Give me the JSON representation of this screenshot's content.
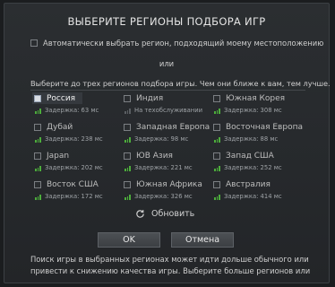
{
  "dialog": {
    "title": "ВЫБЕРИТЕ РЕГИОНЫ ПОДБОРА ИГР",
    "auto_select_label": "Автоматически выбрать регион, подходящий моему местоположению",
    "auto_select_checked": false,
    "or_label": "или",
    "instructions": "Выберите до трех регионов подбора игры. Чем они ближе к вам, тем лучше.",
    "regions": [
      {
        "name": "Россия",
        "latency": "Задержка: 63 мс",
        "selected": true,
        "signal": "good"
      },
      {
        "name": "Индия",
        "latency": "На техобслуживании",
        "selected": false,
        "signal": "off"
      },
      {
        "name": "Южная Корея",
        "latency": "Задержка: 308 мс",
        "selected": false,
        "signal": "good"
      },
      {
        "name": "Дубай",
        "latency": "Задержка: 238 мс",
        "selected": false,
        "signal": "good"
      },
      {
        "name": "Западная Европа",
        "latency": "Задержка: 98 мс",
        "selected": false,
        "signal": "good"
      },
      {
        "name": "Восточная Европа",
        "latency": "Задержка: 88 мс",
        "selected": false,
        "signal": "good"
      },
      {
        "name": "Japan",
        "latency": "Задержка: 202 мс",
        "selected": false,
        "signal": "good"
      },
      {
        "name": "ЮВ Азия",
        "latency": "Задержка: 221 мс",
        "selected": false,
        "signal": "good"
      },
      {
        "name": "Запад США",
        "latency": "Задержка: 252 мс",
        "selected": false,
        "signal": "good"
      },
      {
        "name": "Восток США",
        "latency": "Задержка: 172 мс",
        "selected": false,
        "signal": "good"
      },
      {
        "name": "Южная Африка",
        "latency": "Задержка: 326 мс",
        "selected": false,
        "signal": "good"
      },
      {
        "name": "Австралия",
        "latency": "Задержка: 414 мс",
        "selected": false,
        "signal": "good"
      }
    ],
    "refresh_label": "Обновить",
    "ok_label": "OK",
    "cancel_label": "Отмена",
    "footer_lines": [
      "Поиск игры в выбранных регионах может идти дольше обычного или",
      "привести к снижению качества игры. Выберите больше регионов или испо..."
    ]
  },
  "colors": {
    "signal_green": "#4cae3b",
    "background": "#1b1d1f",
    "panel": "#2b2e31"
  }
}
